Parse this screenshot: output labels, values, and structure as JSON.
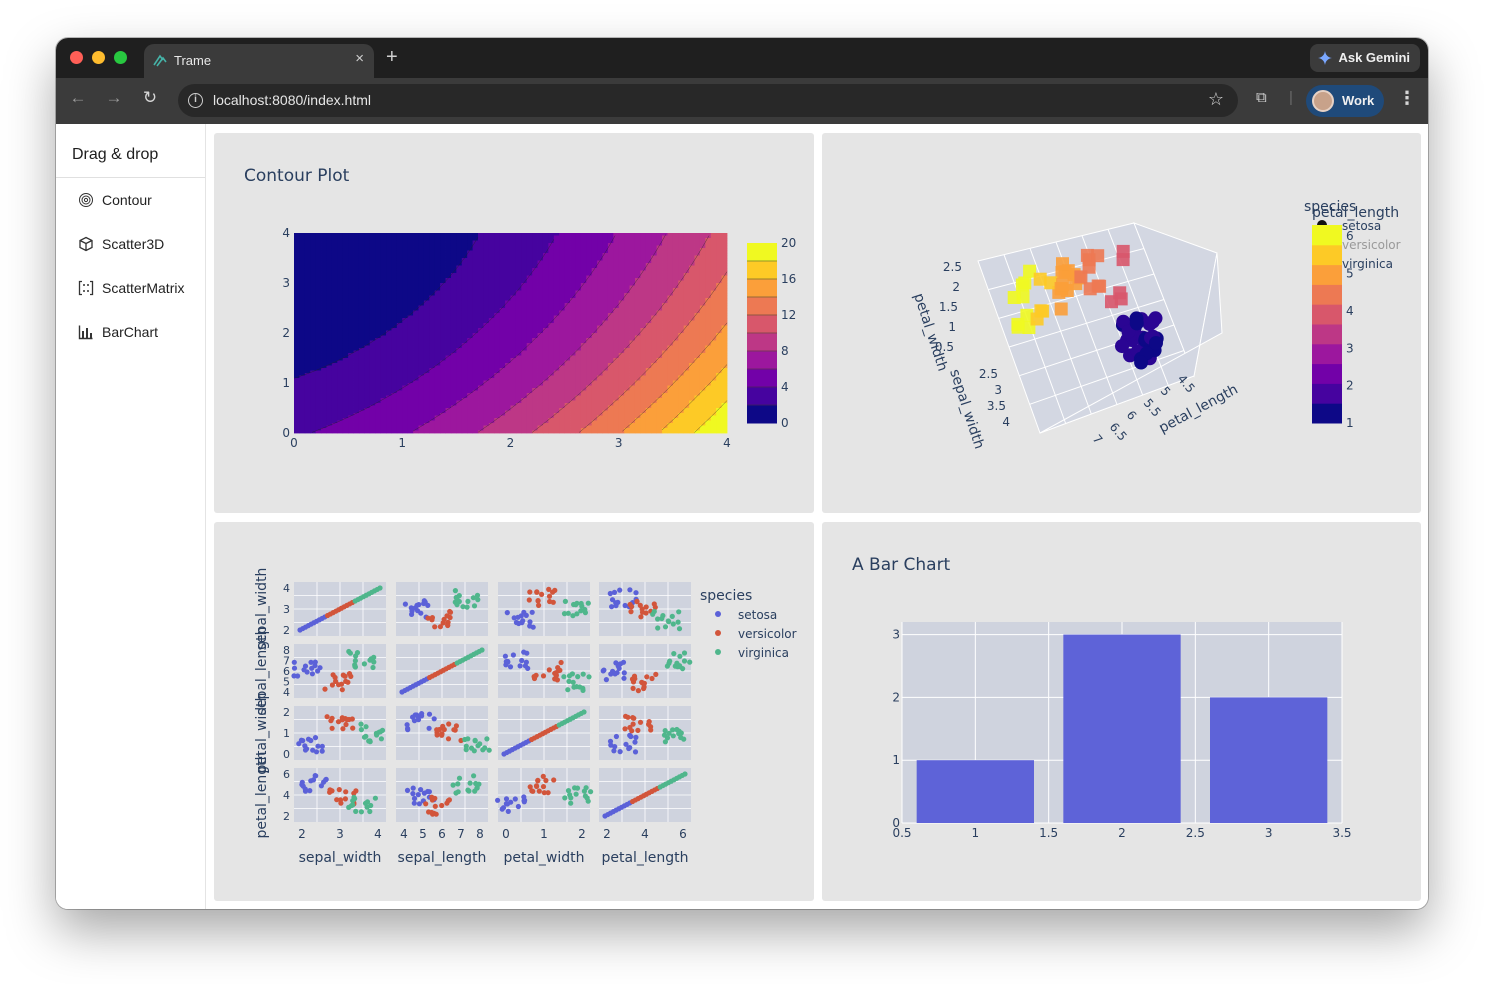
{
  "browser": {
    "tab_title": "Trame",
    "new_tab": "+",
    "close": "×",
    "gemini_label": "Ask Gemini",
    "url": "localhost:8080/index.html",
    "profile_label": "Work"
  },
  "sidebar": {
    "title": "Drag & drop",
    "items": [
      {
        "label": "Contour",
        "icon": "fingerprint-icon"
      },
      {
        "label": "Scatter3D",
        "icon": "cube-icon"
      },
      {
        "label": "ScatterMatrix",
        "icon": "matrix-icon"
      },
      {
        "label": "BarChart",
        "icon": "bar-chart-icon"
      }
    ]
  },
  "colors": {
    "panel_bg": "#e5e5e5",
    "plot_bg": "#cfd3de",
    "bar": "#5e63d8",
    "setosa": "#5b61d8",
    "versicolor": "#d2553b",
    "virginica": "#4fb68c"
  },
  "chart_data": [
    {
      "type": "contour",
      "title": "Contour Plot",
      "x_ticks": [
        "0",
        "1",
        "2",
        "3",
        "4"
      ],
      "y_ticks": [
        "0",
        "1",
        "2",
        "3",
        "4"
      ],
      "xlim": [
        0,
        4
      ],
      "ylim": [
        0,
        4
      ],
      "colorbar_ticks": [
        "0",
        "4",
        "8",
        "12",
        "16",
        "20"
      ],
      "colorbar_range": [
        0,
        20
      ],
      "colorscale": [
        "#0d0887",
        "#46039f",
        "#7201a8",
        "#9c179e",
        "#bd3786",
        "#d8576b",
        "#ed7953",
        "#fb9f3a",
        "#fdca26",
        "#f0f921"
      ]
    },
    {
      "type": "scatter3d",
      "axis_labels": {
        "x": "petal_length",
        "y": "sepal_width",
        "z": "petal_width"
      },
      "z_ticks": [
        "2.5",
        "2",
        "1.5",
        "1",
        "0.5"
      ],
      "y_ticks": [
        "2.5",
        "3",
        "3.5",
        "4"
      ],
      "x_ticks": [
        "4.5",
        "5",
        "5.5",
        "6",
        "6.5",
        "7"
      ],
      "legend_title": "species",
      "legend": [
        "setosa",
        "versicolor",
        "virginica"
      ],
      "colorbar_title": "petal_length",
      "colorbar_ticks": [
        "1",
        "2",
        "3",
        "4",
        "5",
        "6"
      ]
    },
    {
      "type": "scatter_matrix",
      "dimensions": [
        "sepal_width",
        "sepal_length",
        "petal_width",
        "petal_length"
      ],
      "row_ticks": [
        [
          "2",
          "3",
          "4"
        ],
        [
          "4",
          "5",
          "6",
          "7",
          "8"
        ],
        [
          "0",
          "1",
          "2"
        ],
        [
          "2",
          "4",
          "6"
        ]
      ],
      "col_ticks": [
        [
          "2",
          "3",
          "4"
        ],
        [
          "4",
          "5",
          "6",
          "7",
          "8"
        ],
        [
          "0",
          "1",
          "2"
        ],
        [
          "2",
          "4",
          "6"
        ]
      ],
      "legend_title": "species",
      "legend": [
        "setosa",
        "versicolor",
        "virginica"
      ]
    },
    {
      "type": "bar",
      "title": "A Bar Chart",
      "x": [
        1,
        2,
        3
      ],
      "values": [
        1,
        3,
        2
      ],
      "xlim": [
        0.5,
        3.5
      ],
      "ylim": [
        0,
        3.2
      ],
      "x_ticks": [
        "0.5",
        "1",
        "1.5",
        "2",
        "2.5",
        "3",
        "3.5"
      ],
      "y_ticks": [
        "0",
        "1",
        "2",
        "3"
      ]
    }
  ]
}
